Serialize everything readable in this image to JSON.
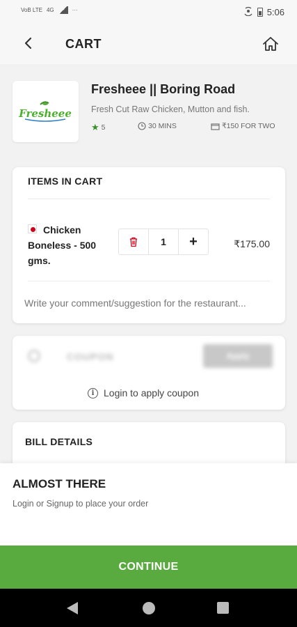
{
  "status_bar": {
    "network_left": "VoB LTE",
    "network_4g": "4G",
    "dots": "···",
    "time": "5:06"
  },
  "header": {
    "title": "CART"
  },
  "restaurant": {
    "logo_text": "Fresheee",
    "name": "Fresheee || Boring Road",
    "description": "Fresh Cut Raw Chicken, Mutton and fish.",
    "rating": "5",
    "delivery_time": "30 MINS",
    "cost_for_two": "₹150 FOR TWO"
  },
  "cart": {
    "section_title": "ITEMS IN CART",
    "items": [
      {
        "name": "Chicken Boneless - 500 gms.",
        "quantity": "1",
        "price": "₹175.00"
      }
    ],
    "comment_placeholder": "Write your comment/suggestion for the restaurant..."
  },
  "coupon": {
    "label": "COUPON",
    "apply_label": "Apply",
    "login_note": "Login to apply coupon"
  },
  "bill": {
    "title": "BILL DETAILS"
  },
  "bottom_sheet": {
    "title": "ALMOST THERE",
    "subtitle": "Login or Signup to place your order",
    "continue_label": "CONTINUE"
  },
  "colors": {
    "accent": "#5aab3f",
    "rating_star": "#3a8f2a",
    "nonveg_dot": "#d0021b",
    "delete_icon": "#d0021b"
  }
}
